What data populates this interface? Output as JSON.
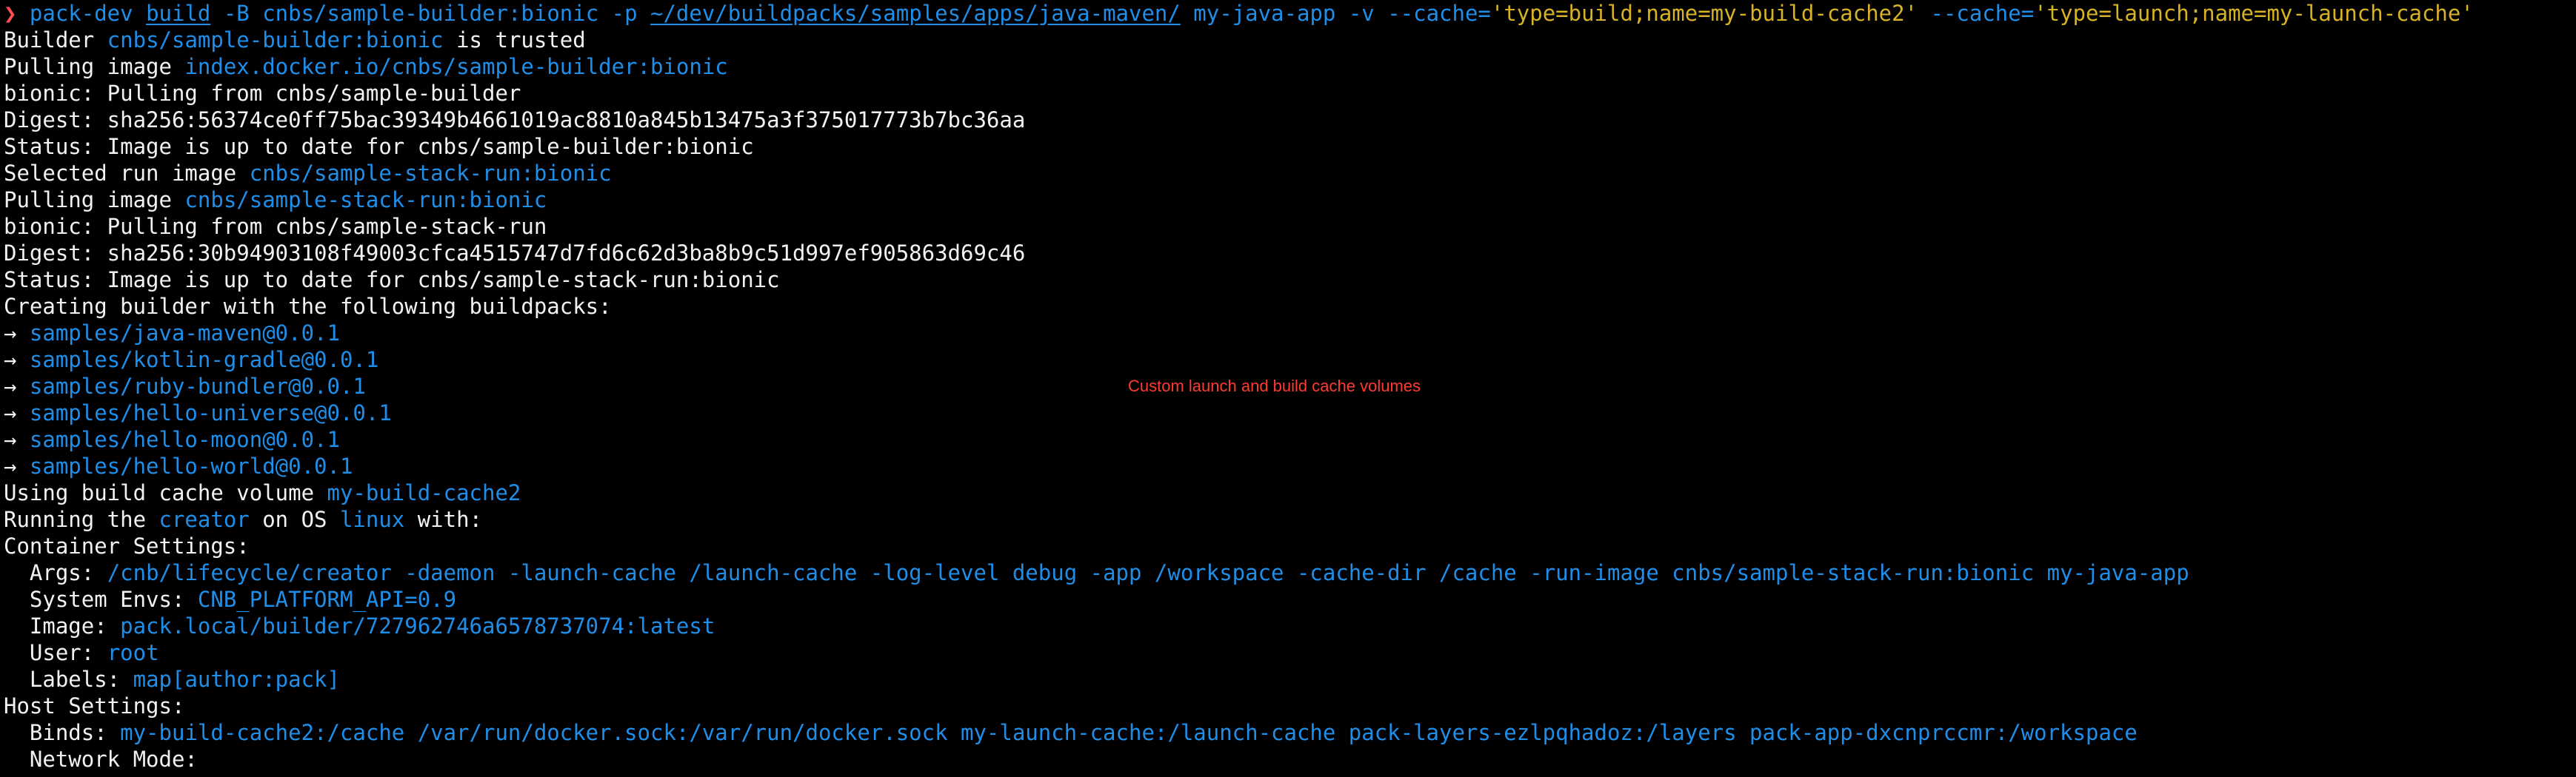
{
  "colors": {
    "background": "#000000",
    "text": "#f2f2f2",
    "accent_blue": "#1f8ee8",
    "accent_yellow": "#d7b224",
    "prompt_red": "#ff4f4f",
    "annotation_red": "#ff3b30"
  },
  "annotation": "Custom launch and build cache volumes",
  "lines": [
    [
      {
        "t": "❯ ",
        "c": "red"
      },
      {
        "t": "pack-dev ",
        "c": "blue"
      },
      {
        "t": "build",
        "c": "path"
      },
      {
        "t": " -B cnbs/sample-builder:bionic -p ",
        "c": "blue"
      },
      {
        "t": "~/dev/buildpacks/samples/apps/java-maven/",
        "c": "path"
      },
      {
        "t": " my-java-app -v --cache=",
        "c": "blue"
      },
      {
        "t": "'type=build;name=my-build-cache2'",
        "c": "yellow"
      },
      {
        "t": " --cache=",
        "c": "blue"
      },
      {
        "t": "'type=launch;name=my-launch-cache'",
        "c": "yellow"
      }
    ],
    [
      {
        "t": "Builder ",
        "c": "plain"
      },
      {
        "t": "cnbs/sample-builder:bionic",
        "c": "blue"
      },
      {
        "t": " is trusted",
        "c": "plain"
      }
    ],
    [
      {
        "t": "Pulling image ",
        "c": "plain"
      },
      {
        "t": "index.docker.io/cnbs/sample-builder:bionic",
        "c": "blue"
      }
    ],
    [
      {
        "t": "bionic: Pulling from cnbs/sample-builder",
        "c": "plain"
      }
    ],
    [
      {
        "t": "Digest: sha256:56374ce0ff75bac39349b4661019ac8810a845b13475a3f375017773b7bc36aa",
        "c": "plain"
      }
    ],
    [
      {
        "t": "Status: Image is up to date for cnbs/sample-builder:bionic",
        "c": "plain"
      }
    ],
    [
      {
        "t": "Selected run image ",
        "c": "plain"
      },
      {
        "t": "cnbs/sample-stack-run:bionic",
        "c": "blue"
      }
    ],
    [
      {
        "t": "Pulling image ",
        "c": "plain"
      },
      {
        "t": "cnbs/sample-stack-run:bionic",
        "c": "blue"
      }
    ],
    [
      {
        "t": "bionic: Pulling from cnbs/sample-stack-run",
        "c": "plain"
      }
    ],
    [
      {
        "t": "Digest: sha256:30b94903108f49003cfca4515747d7fd6c62d3ba8b9c51d997ef905863d69c46",
        "c": "plain"
      }
    ],
    [
      {
        "t": "Status: Image is up to date for cnbs/sample-stack-run:bionic",
        "c": "plain"
      }
    ],
    [
      {
        "t": "Creating builder with the following buildpacks:",
        "c": "plain"
      }
    ],
    [
      {
        "t": "→ ",
        "c": "plain"
      },
      {
        "t": "samples/java-maven@0.0.1",
        "c": "blue"
      }
    ],
    [
      {
        "t": "→ ",
        "c": "plain"
      },
      {
        "t": "samples/kotlin-gradle@0.0.1",
        "c": "blue"
      }
    ],
    [
      {
        "t": "→ ",
        "c": "plain"
      },
      {
        "t": "samples/ruby-bundler@0.0.1",
        "c": "blue"
      }
    ],
    [
      {
        "t": "→ ",
        "c": "plain"
      },
      {
        "t": "samples/hello-universe@0.0.1",
        "c": "blue"
      }
    ],
    [
      {
        "t": "→ ",
        "c": "plain"
      },
      {
        "t": "samples/hello-moon@0.0.1",
        "c": "blue"
      }
    ],
    [
      {
        "t": "→ ",
        "c": "plain"
      },
      {
        "t": "samples/hello-world@0.0.1",
        "c": "blue"
      }
    ],
    [
      {
        "t": "Using build cache volume ",
        "c": "plain"
      },
      {
        "t": "my-build-cache2",
        "c": "blue"
      }
    ],
    [
      {
        "t": "Running the ",
        "c": "plain"
      },
      {
        "t": "creator",
        "c": "blue"
      },
      {
        "t": " on OS ",
        "c": "plain"
      },
      {
        "t": "linux",
        "c": "blue"
      },
      {
        "t": " with:",
        "c": "plain"
      }
    ],
    [
      {
        "t": "Container Settings:",
        "c": "plain"
      }
    ],
    [
      {
        "t": "  Args: ",
        "c": "plain"
      },
      {
        "t": "/cnb/lifecycle/creator -daemon -launch-cache /launch-cache -log-level debug -app /workspace -cache-dir /cache -run-image cnbs/sample-stack-run:bionic my-java-app",
        "c": "blue"
      }
    ],
    [
      {
        "t": "  System Envs: ",
        "c": "plain"
      },
      {
        "t": "CNB_PLATFORM_API=0.9",
        "c": "blue"
      }
    ],
    [
      {
        "t": "  Image: ",
        "c": "plain"
      },
      {
        "t": "pack.local/builder/727962746a6578737074:latest",
        "c": "blue"
      }
    ],
    [
      {
        "t": "  User: ",
        "c": "plain"
      },
      {
        "t": "root",
        "c": "blue"
      }
    ],
    [
      {
        "t": "  Labels: ",
        "c": "plain"
      },
      {
        "t": "map[author:pack]",
        "c": "blue"
      }
    ],
    [
      {
        "t": "Host Settings:",
        "c": "plain"
      }
    ],
    [
      {
        "t": "  Binds: ",
        "c": "plain"
      },
      {
        "t": "my-build-cache2:/cache /var/run/docker.sock:/var/run/docker.sock my-launch-cache:/launch-cache pack-layers-ezlpqhadoz:/layers pack-app-dxcnprccmr:/workspace",
        "c": "blue"
      }
    ],
    [
      {
        "t": "  Network Mode:",
        "c": "plain"
      }
    ]
  ]
}
